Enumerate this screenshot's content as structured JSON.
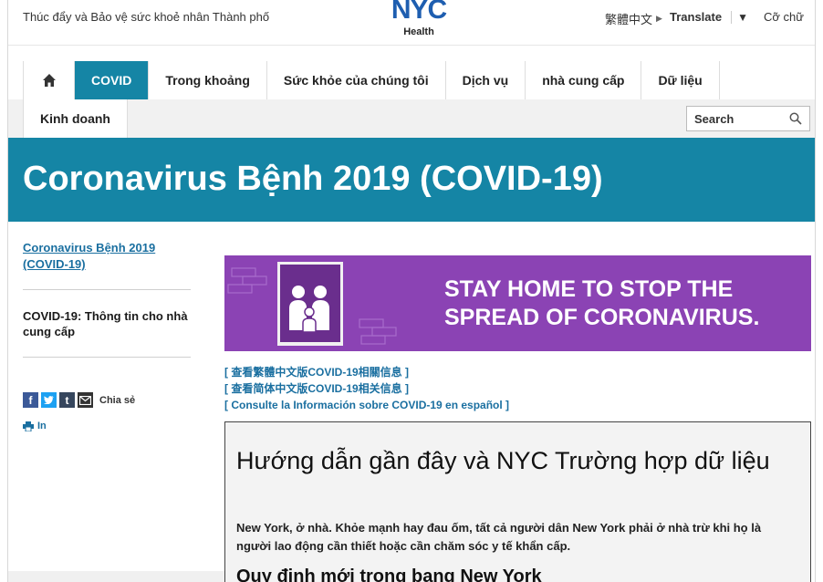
{
  "topbar": {
    "tagline": "Thúc đẩy và Bảo vệ sức khoẻ nhân Thành phố",
    "logo_mark": "NYC",
    "logo_sub": "Health",
    "language": "繁體中文",
    "translate": "Translate",
    "translate_dropdown": "▼",
    "text_size": "Cỡ chữ"
  },
  "nav": {
    "items": [
      {
        "label": "COVID"
      },
      {
        "label": "Trong khoảng"
      },
      {
        "label": "Sức khỏe của chúng tôi"
      },
      {
        "label": "Dịch vụ"
      },
      {
        "label": "nhà cung cấp"
      },
      {
        "label": "Dữ liệu"
      }
    ],
    "row2_item": "Kinh doanh",
    "search_placeholder": "Search",
    "active_color": "#1585a5"
  },
  "hero": {
    "title": "Coronavirus Bệnh 2019 (COVID-19)"
  },
  "sidebar": {
    "link": "Coronavirus Bệnh 2019 (COVID-19)",
    "heading": "COVID-19: Thông tin cho nhà cung cấp",
    "share_label": "Chia sẻ",
    "print_label": "In"
  },
  "banner": {
    "text": "STAY HOME TO STOP THE SPREAD OF CORONAVIRUS.",
    "color": "#8b43b4"
  },
  "language_links": [
    "[ 查看繁體中文版COVID-19相關信息 ]",
    "[ 查看简体中文版COVID-19相关信息 ]",
    "[ Consulte la Información sobre COVID-19 en español ]"
  ],
  "content": {
    "heading": "Hướng dẫn gần đây và NYC Trường hợp dữ liệu",
    "paragraph": "New York, ở nhà. Khỏe mạnh hay đau ốm, tất cả người dân New York phải ở nhà trừ khi họ là người lao động cần thiết hoặc cần chăm sóc y tế khẩn cấp.",
    "subheading": "Quy định mới trong bang New York"
  }
}
